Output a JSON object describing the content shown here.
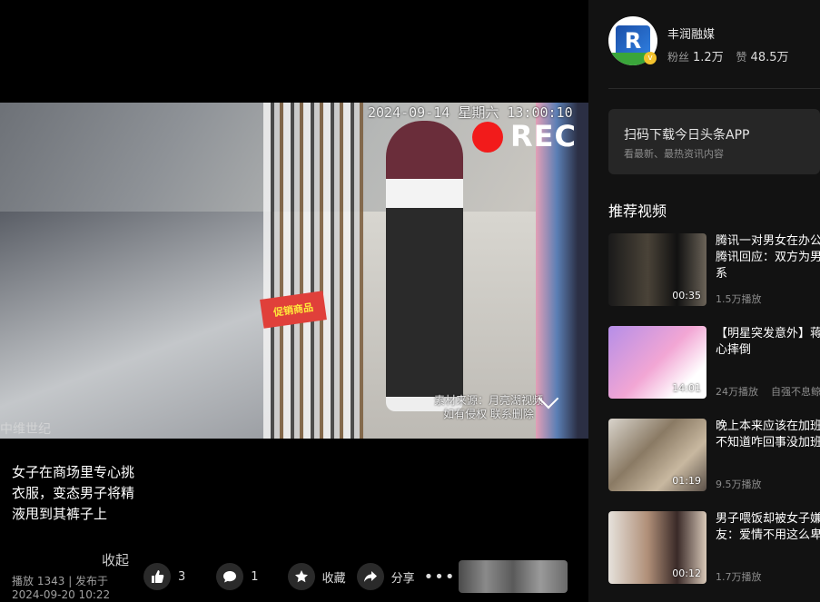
{
  "player": {
    "osd_time": "2024-09-14 星期六 13:00:10",
    "rec_label": "REC",
    "watermark_line1": "素材来源：月亮湖视频",
    "watermark_line2": "如有侵权 联系删除",
    "watermark_left": "中维世纪",
    "promo_sign": "促销商品"
  },
  "post": {
    "title": "女子在商场里专心挑衣服，变态男子将精液甩到其裤子上",
    "collapse_label": "收起",
    "plays": "播放 1343",
    "publish": "发布于 2024-09-20 10:22"
  },
  "actions": {
    "like_count": "3",
    "comment_count": "1",
    "collect_label": "收藏",
    "share_label": "分享",
    "more_label": "•••"
  },
  "author": {
    "name": "丰润融媒",
    "fans_label": "粉丝",
    "fans": "1.2万",
    "likes_label": "赞",
    "likes": "48.5万"
  },
  "app_promo": {
    "title": "扫码下载今日头条APP",
    "subtitle": "看最新、最热资讯内容"
  },
  "recommend": {
    "heading": "推荐视频",
    "items": [
      {
        "title1": "腾讯一对男女在办公",
        "title2": "腾讯回应：双方为男",
        "title3": "系",
        "duration": "00:35",
        "plays": "1.5万播放",
        "author": ""
      },
      {
        "title1": "【明星突发意外】蒋",
        "title2": "心摔倒",
        "title3": "",
        "duration": "14:01",
        "plays": "24万播放",
        "author": "自强不息鲸"
      },
      {
        "title1": "晚上本来应该在加班",
        "title2": "不知道咋回事没加班",
        "title3": "",
        "duration": "01:19",
        "plays": "9.5万播放",
        "author": ""
      },
      {
        "title1": "男子喂饭却被女子嫌",
        "title2": "友：爱情不用这么卑",
        "title3": "",
        "duration": "00:12",
        "plays": "1.7万播放",
        "author": ""
      }
    ]
  },
  "colors": {
    "sidebar_bg": "#121212",
    "card_bg": "#262626",
    "rec_red": "#f21b1b"
  }
}
